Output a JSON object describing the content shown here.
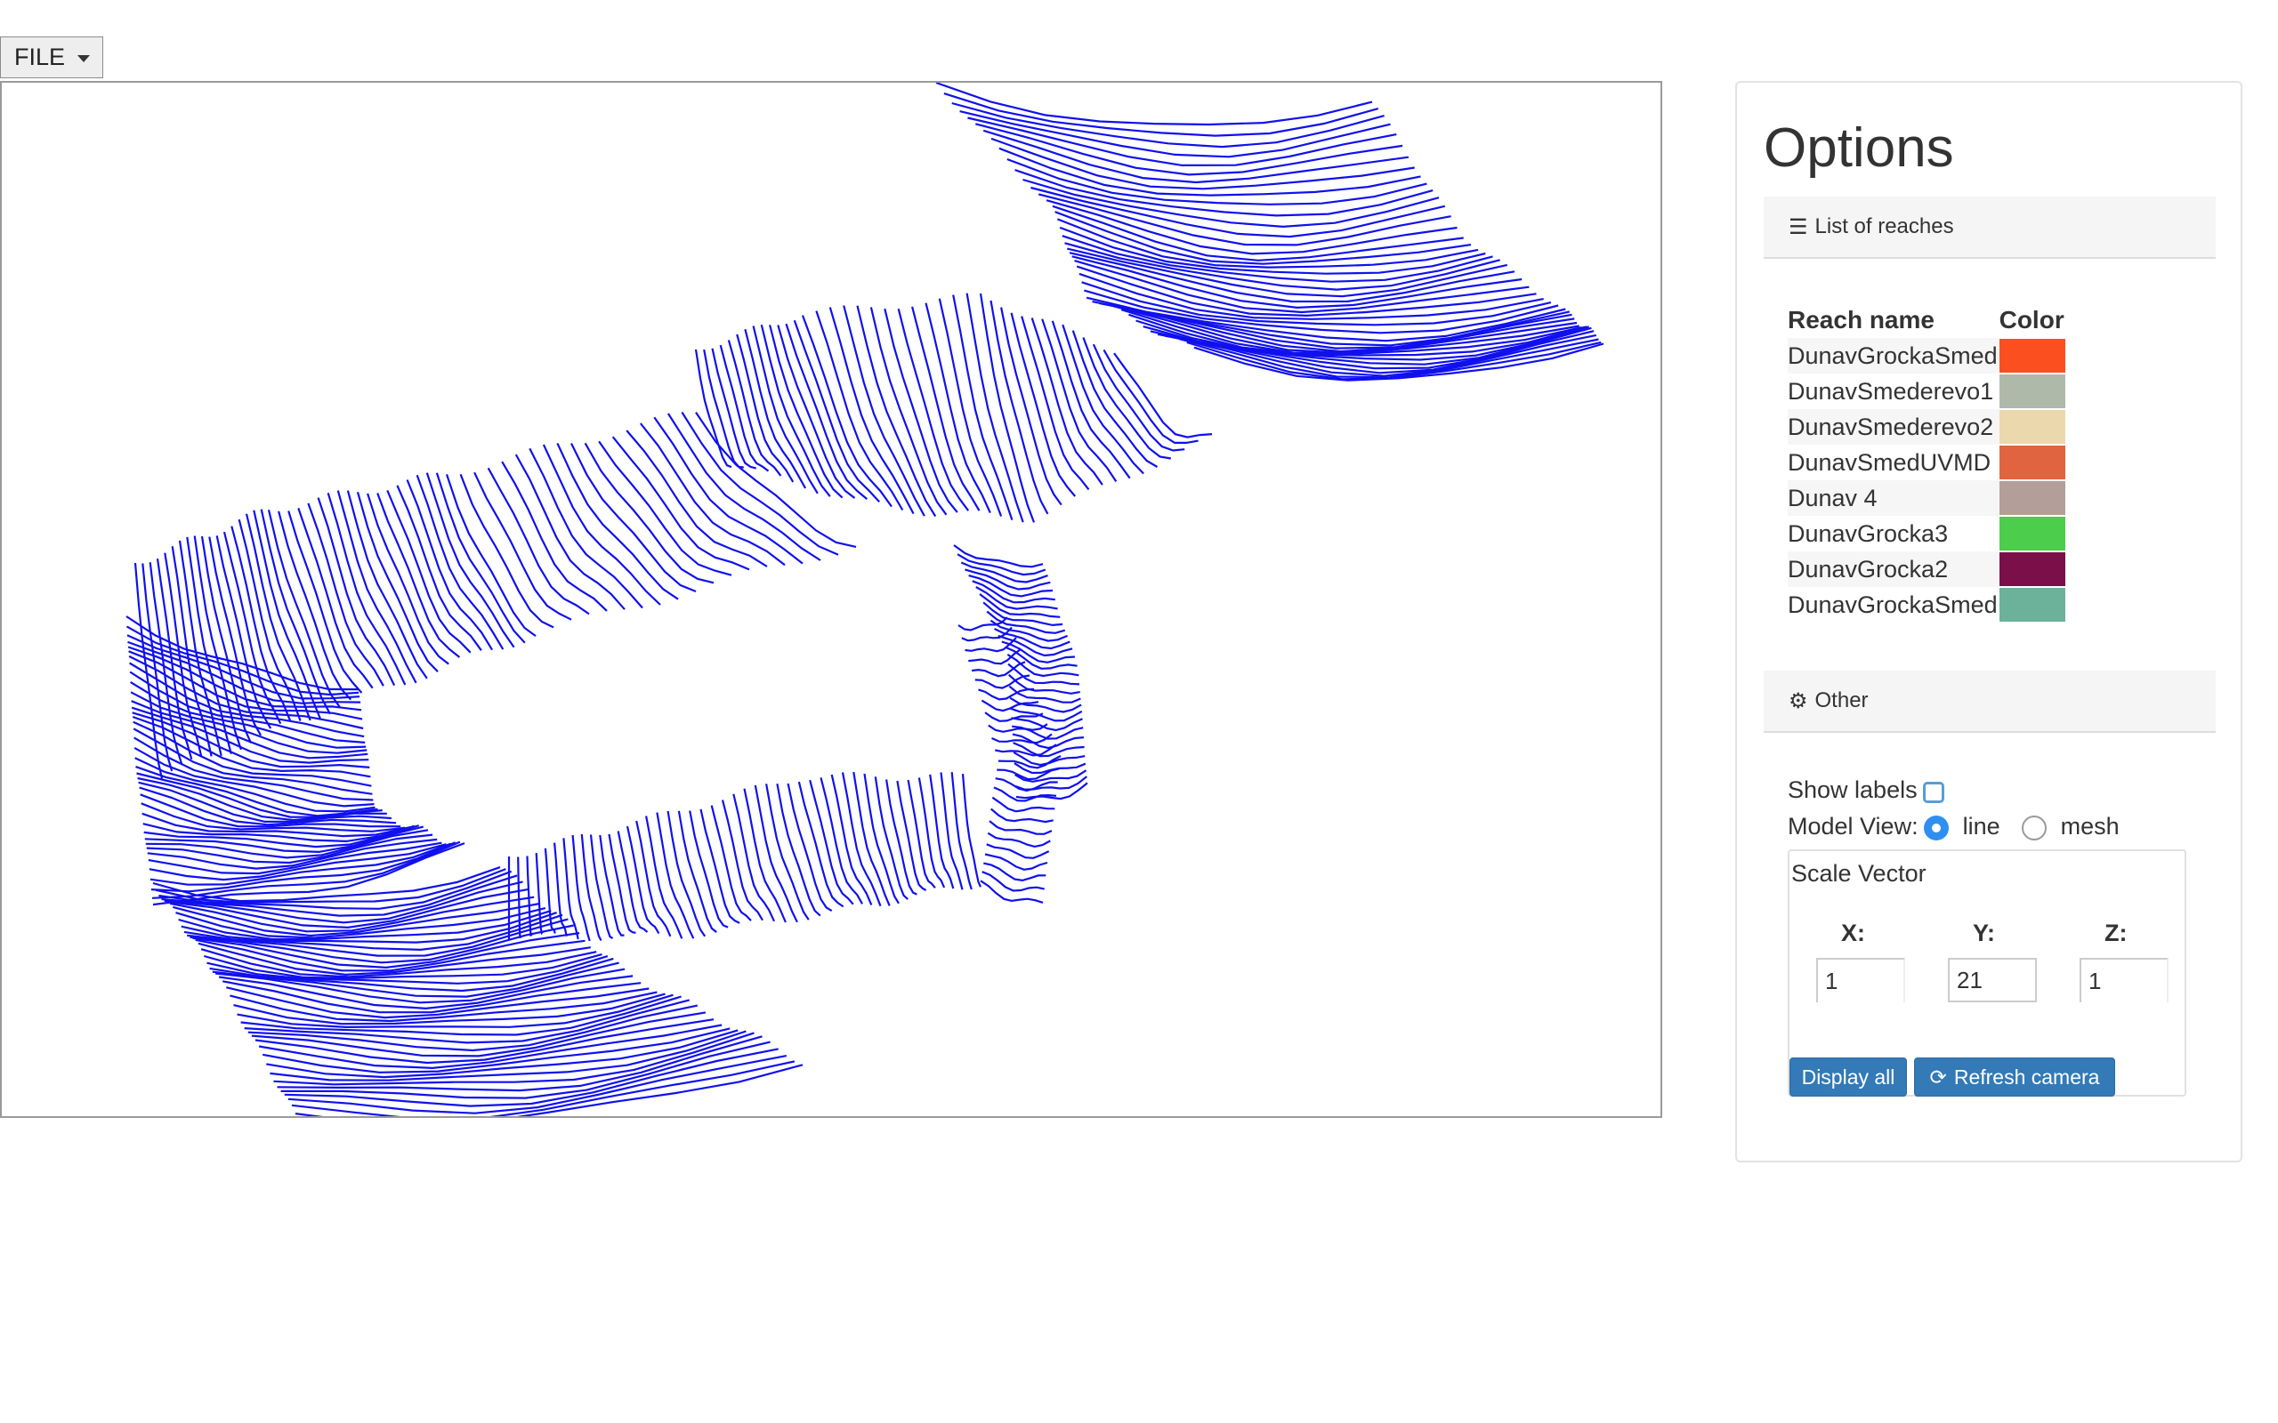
{
  "file_menu": {
    "label": "FILE"
  },
  "options": {
    "title": "Options",
    "list_of_reaches": {
      "header": "List of reaches",
      "columns": [
        "Reach name",
        "Color"
      ],
      "reaches": [
        {
          "name": "DunavGrockaSmed",
          "color": "#fb4f1f"
        },
        {
          "name": "DunavSmederevo1",
          "color": "#afb9a9"
        },
        {
          "name": "DunavSmederevo2",
          "color": "#ecd8ad"
        },
        {
          "name": "DunavSmedUVMD",
          "color": "#e0643f"
        },
        {
          "name": "Dunav 4",
          "color": "#b39e9a"
        },
        {
          "name": "DunavGrocka3",
          "color": "#4ccd4c"
        },
        {
          "name": "DunavGrocka2",
          "color": "#7a0f4a"
        },
        {
          "name": "DunavGrockaSmed",
          "color": "#6cb29a"
        }
      ]
    },
    "other": {
      "header": "Other",
      "show_labels": {
        "label": "Show labels",
        "checked": false
      },
      "model_view": {
        "label": "Model View:",
        "options": [
          "line",
          "mesh"
        ],
        "selected": "line"
      },
      "scale_vector": {
        "title": "Scale Vector",
        "x_label": "X:",
        "y_label": "Y:",
        "z_label": "Z:",
        "x": "1",
        "y": "21",
        "z": "1"
      },
      "display_all_label": "Display all",
      "refresh_camera_label": "Refresh camera"
    }
  },
  "viewport": {
    "line_color": "#1010ee",
    "icons": {
      "list": "list-icon",
      "gear": "gear-icon",
      "refresh": "refresh-icon"
    }
  }
}
